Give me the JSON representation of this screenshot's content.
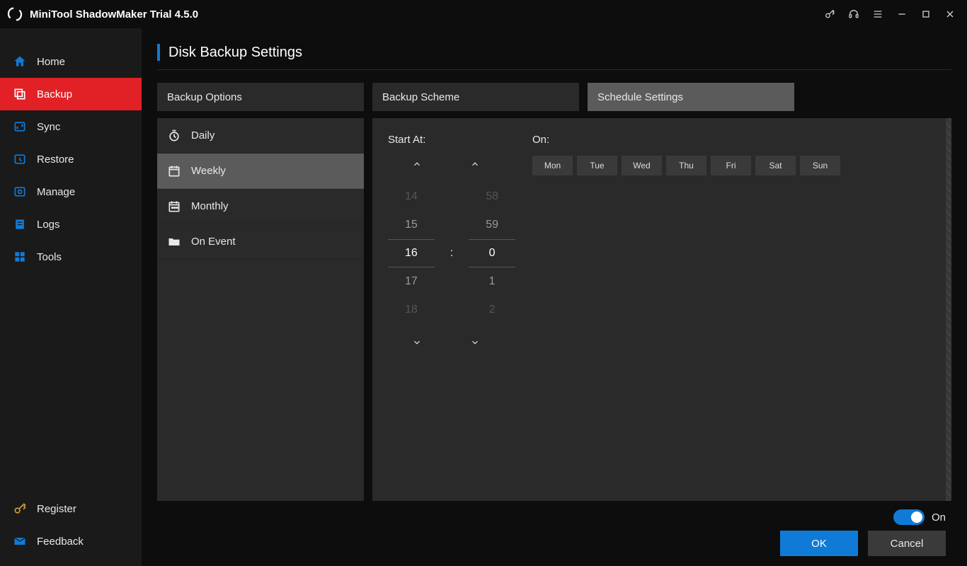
{
  "app": {
    "title": "MiniTool ShadowMaker Trial 4.5.0"
  },
  "sidebar": {
    "items": [
      {
        "label": "Home"
      },
      {
        "label": "Backup"
      },
      {
        "label": "Sync"
      },
      {
        "label": "Restore"
      },
      {
        "label": "Manage"
      },
      {
        "label": "Logs"
      },
      {
        "label": "Tools"
      }
    ],
    "bottom": [
      {
        "label": "Register"
      },
      {
        "label": "Feedback"
      }
    ]
  },
  "page": {
    "title": "Disk Backup Settings"
  },
  "tabs": [
    {
      "label": "Backup Options"
    },
    {
      "label": "Backup Scheme"
    },
    {
      "label": "Schedule Settings"
    }
  ],
  "freq": [
    {
      "label": "Daily"
    },
    {
      "label": "Weekly"
    },
    {
      "label": "Monthly"
    },
    {
      "label": "On Event"
    }
  ],
  "schedule": {
    "start_label": "Start At:",
    "on_label": "On:",
    "hour_wheel": [
      "14",
      "15",
      "16",
      "17",
      "18"
    ],
    "min_wheel": [
      "58",
      "59",
      "0",
      "1",
      "2"
    ],
    "colon": ":",
    "days": [
      "Mon",
      "Tue",
      "Wed",
      "Thu",
      "Fri",
      "Sat",
      "Sun"
    ]
  },
  "footer": {
    "toggle_label": "On",
    "ok": "OK",
    "cancel": "Cancel"
  }
}
